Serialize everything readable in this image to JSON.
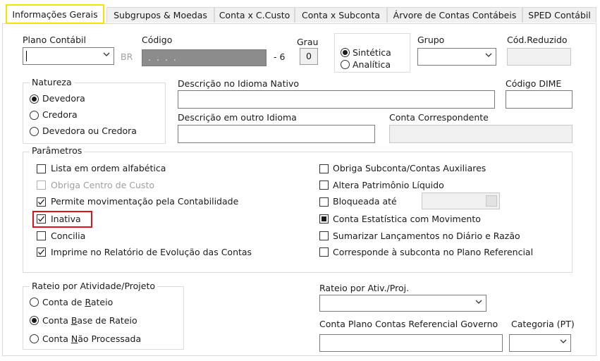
{
  "tabs": [
    {
      "label": "Informações Gerais",
      "active": true
    },
    {
      "label": "Subgrupos & Moedas"
    },
    {
      "label": "Conta x C.Custo"
    },
    {
      "label": "Conta x Subconta"
    },
    {
      "label": "Árvore de Contas Contábeis"
    },
    {
      "label": "SPED Contábil"
    }
  ],
  "top": {
    "plano_label": "Plano Contábil",
    "plano_value": "",
    "br_label": "BR",
    "codigo_label": "Código",
    "codigo_mask": ". . . .",
    "codigo_suffix": "- 6",
    "grau_label": "Grau",
    "grau_value": "0",
    "sintetica_label": "Sintética",
    "analitica_label": "Analítica",
    "grupo_label": "Grupo",
    "grupo_value": "",
    "codreduzido_label": "Cód.Reduzido"
  },
  "natureza": {
    "title": "Natureza",
    "options": [
      "Devedora",
      "Credora",
      "Devedora ou Credora"
    ],
    "selected": "Devedora"
  },
  "descricao": {
    "nativo_label": "Descrição no Idioma Nativo",
    "dime_label": "Código DIME",
    "outro_label": "Descrição em outro Idioma",
    "correspondente_label": "Conta Correspondente"
  },
  "parametros": {
    "title": "Parâmetros",
    "left": [
      {
        "label": "Lista em ordem alfabética",
        "checked": false
      },
      {
        "label": "Obriga Centro de Custo",
        "checked": false,
        "disabled": true
      },
      {
        "label": "Permite movimentação pela Contabilidade",
        "checked": true
      },
      {
        "label": "Inativa",
        "checked": true,
        "highlighted": true
      },
      {
        "label": "Concilia",
        "checked": false
      },
      {
        "label": "Imprime no Relatório de Evolução das Contas",
        "checked": true
      }
    ],
    "right": [
      {
        "label": "Obriga Subconta/Contas Auxiliares",
        "checked": false
      },
      {
        "label": "Altera Patrimônio Líquido",
        "checked": false
      },
      {
        "label": "Bloqueada até",
        "checked": false
      },
      {
        "label": "Conta Estatística com Movimento",
        "checked": "indeterminate"
      },
      {
        "label": "Sumarizar Lançamentos no Diário e Razão",
        "checked": false
      },
      {
        "label": "Corresponde à subconta no Plano Referencial",
        "checked": false
      }
    ]
  },
  "rateio": {
    "title": "Rateio por Atividade/Projeto",
    "options": [
      {
        "before": "Conta de ",
        "accel": "R",
        "after": "ateio"
      },
      {
        "before": "Conta ",
        "accel": "B",
        "after": "ase de Rateio"
      },
      {
        "before": "Conta ",
        "accel": "N",
        "after": "ão Processada"
      }
    ],
    "selected_index": 1
  },
  "rateio_proj": {
    "label": "Rateio por Ativ./Proj.",
    "referencial_label": "Conta Plano Contas Referencial Governo",
    "categoria_label": "Categoria (PT)"
  }
}
